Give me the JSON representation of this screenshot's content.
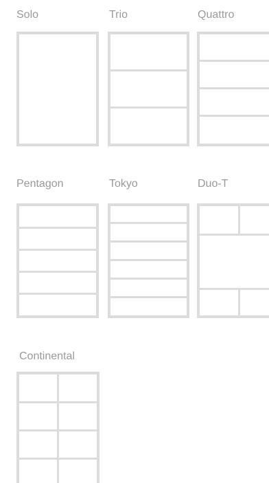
{
  "layouts": [
    {
      "label": "Solo"
    },
    {
      "label": "Trio"
    },
    {
      "label": "Quattro"
    },
    {
      "label": "Pentagon"
    },
    {
      "label": "Tokyo"
    },
    {
      "label": "Duo-T"
    },
    {
      "label": "Continental"
    }
  ],
  "colors": {
    "label": "#9a9a9a",
    "tile_stroke": "#dcdcdc",
    "background": "#ffffff"
  }
}
